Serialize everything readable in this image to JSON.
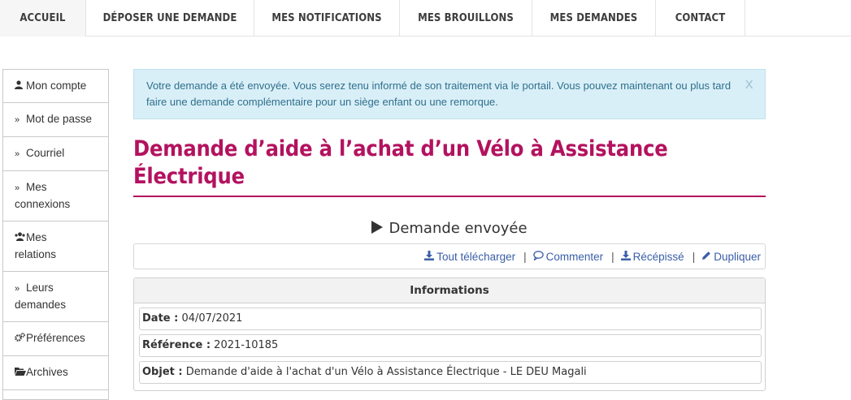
{
  "nav": {
    "items": [
      "ACCUEIL",
      "DÉPOSER UNE DEMANDE",
      "MES NOTIFICATIONS",
      "MES BROUILLONS",
      "MES DEMANDES",
      "CONTACT"
    ]
  },
  "sidebar": {
    "items": [
      {
        "icon": "user-icon",
        "label": "Mon compte"
      },
      {
        "icon": "double-chevron-right-icon",
        "label": "Mot de passe"
      },
      {
        "icon": "double-chevron-right-icon",
        "label": "Courriel"
      },
      {
        "icon": "double-chevron-right-icon",
        "label": "Mes connexions"
      },
      {
        "icon": "users-icon",
        "label": "Mes relations"
      },
      {
        "icon": "double-chevron-right-icon",
        "label": "Leurs demandes"
      },
      {
        "icon": "cogs-icon",
        "label": "Préférences"
      },
      {
        "icon": "folder-open-icon",
        "label": "Archives"
      }
    ]
  },
  "alert": {
    "message": "Votre demande a été envoyée. Vous serez tenu informé de son traitement via le portail. Vous pouvez maintenant ou plus tard faire une demande complémentaire pour un siège enfant ou une remorque.",
    "close_glyph": "x"
  },
  "page": {
    "title": "Demande d’aide à l’achat d’un Vélo à Assistance Électrique",
    "status": "Demande envoyée"
  },
  "actions": {
    "download_all": "Tout télécharger",
    "comment": "Commenter",
    "receipt": "Récépissé",
    "duplicate": "Dupliquer",
    "separator": "|"
  },
  "info": {
    "heading": "Informations",
    "date_label": "Date :",
    "date_value": "04/07/2021",
    "reference_label": "Référence :",
    "reference_value": "2021-10185",
    "object_label": "Objet :",
    "object_value": "Demande d'aide à l'achat d'un Vélo à Assistance Électrique - LE DEU Magali"
  },
  "colors": {
    "accent": "#b3125f",
    "alert_bg": "#d9eff8",
    "link": "#3a5ea8"
  }
}
